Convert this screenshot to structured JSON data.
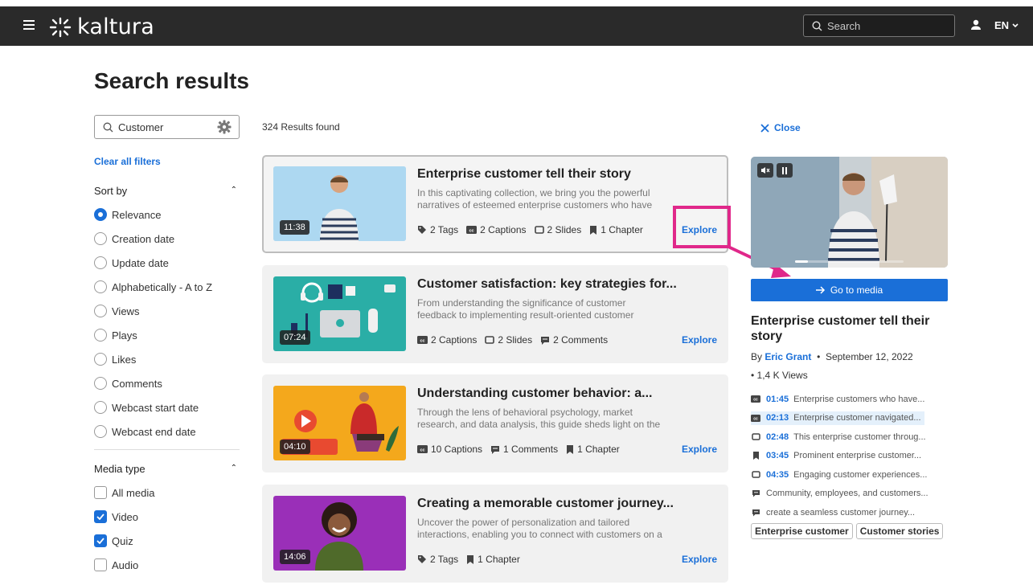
{
  "header": {
    "logo_text": "kaltura",
    "search_placeholder": "Search",
    "language": "EN"
  },
  "page_title": "Search results",
  "filters": {
    "search_value": "Customer",
    "clear_label": "Clear all filters",
    "sort_title": "Sort by",
    "sort_options": [
      "Relevance",
      "Creation date",
      "Update date",
      "Alphabetically - A to Z",
      "Views",
      "Plays",
      "Likes",
      "Comments",
      "Webcast start date",
      "Webcast end date"
    ],
    "sort_selected": "Relevance",
    "media_title": "Media type",
    "media_options": [
      {
        "label": "All media",
        "checked": false
      },
      {
        "label": "Video",
        "checked": true
      },
      {
        "label": "Quiz",
        "checked": true
      },
      {
        "label": "Audio",
        "checked": false
      }
    ]
  },
  "results": {
    "count_label": "324 Results found",
    "explore_label": "Explore",
    "items": [
      {
        "title": "Enterprise customer tell their story",
        "desc": "In this captivating collection, we bring you the powerful narratives of esteemed enterprise customers who have",
        "duration": "11:38",
        "meta": [
          "2 Tags",
          "2 Captions",
          "2 Slides",
          "1 Chapter"
        ]
      },
      {
        "title": "Customer satisfaction: key strategies for...",
        "desc": "From understanding the significance of customer feedback to implementing result-oriented customer",
        "duration": "07:24",
        "meta": [
          "2 Captions",
          "2 Slides",
          "2 Comments"
        ]
      },
      {
        "title": "Understanding customer behavior: a...",
        "desc": "Through the lens of behavioral psychology, market research, and data analysis, this guide sheds light on the",
        "duration": "04:10",
        "meta": [
          "10 Captions",
          "1 Comments",
          "1 Chapter"
        ]
      },
      {
        "title": "Creating a memorable customer journey...",
        "desc": "Uncover the power of personalization and tailored interactions, enabling you to connect with customers on a",
        "duration": "14:06",
        "meta": [
          "2 Tags",
          "1 Chapter"
        ]
      }
    ]
  },
  "side": {
    "close_label": "Close",
    "goto_label": "Go to media",
    "title": "Enterprise customer tell their story",
    "by": "By",
    "author": "Eric Grant",
    "date": "September 12, 2022",
    "views": "1,4 K Views",
    "progress": 0.12,
    "chapters": [
      {
        "icon": "cc",
        "time": "01:45",
        "text": "Enterprise customers who have..."
      },
      {
        "icon": "cc",
        "time": "02:13",
        "text": "Enterprise customer navigated..."
      },
      {
        "icon": "slide",
        "time": "02:48",
        "text": "This enterprise customer throug..."
      },
      {
        "icon": "chapter",
        "time": "03:45",
        "text": "Prominent enterprise customer..."
      },
      {
        "icon": "slide",
        "time": "04:35",
        "text": "Engaging customer experiences..."
      },
      {
        "icon": "comment",
        "time": "",
        "text": "Community, employees, and customers..."
      },
      {
        "icon": "comment",
        "time": "",
        "text": "create a seamless customer journey..."
      }
    ],
    "tags": [
      "Enterprise customer",
      "Customer stories"
    ]
  },
  "colors": {
    "accent": "#1a6fd8",
    "annotation": "#e0288a",
    "header_bg": "#2a2a2a"
  }
}
